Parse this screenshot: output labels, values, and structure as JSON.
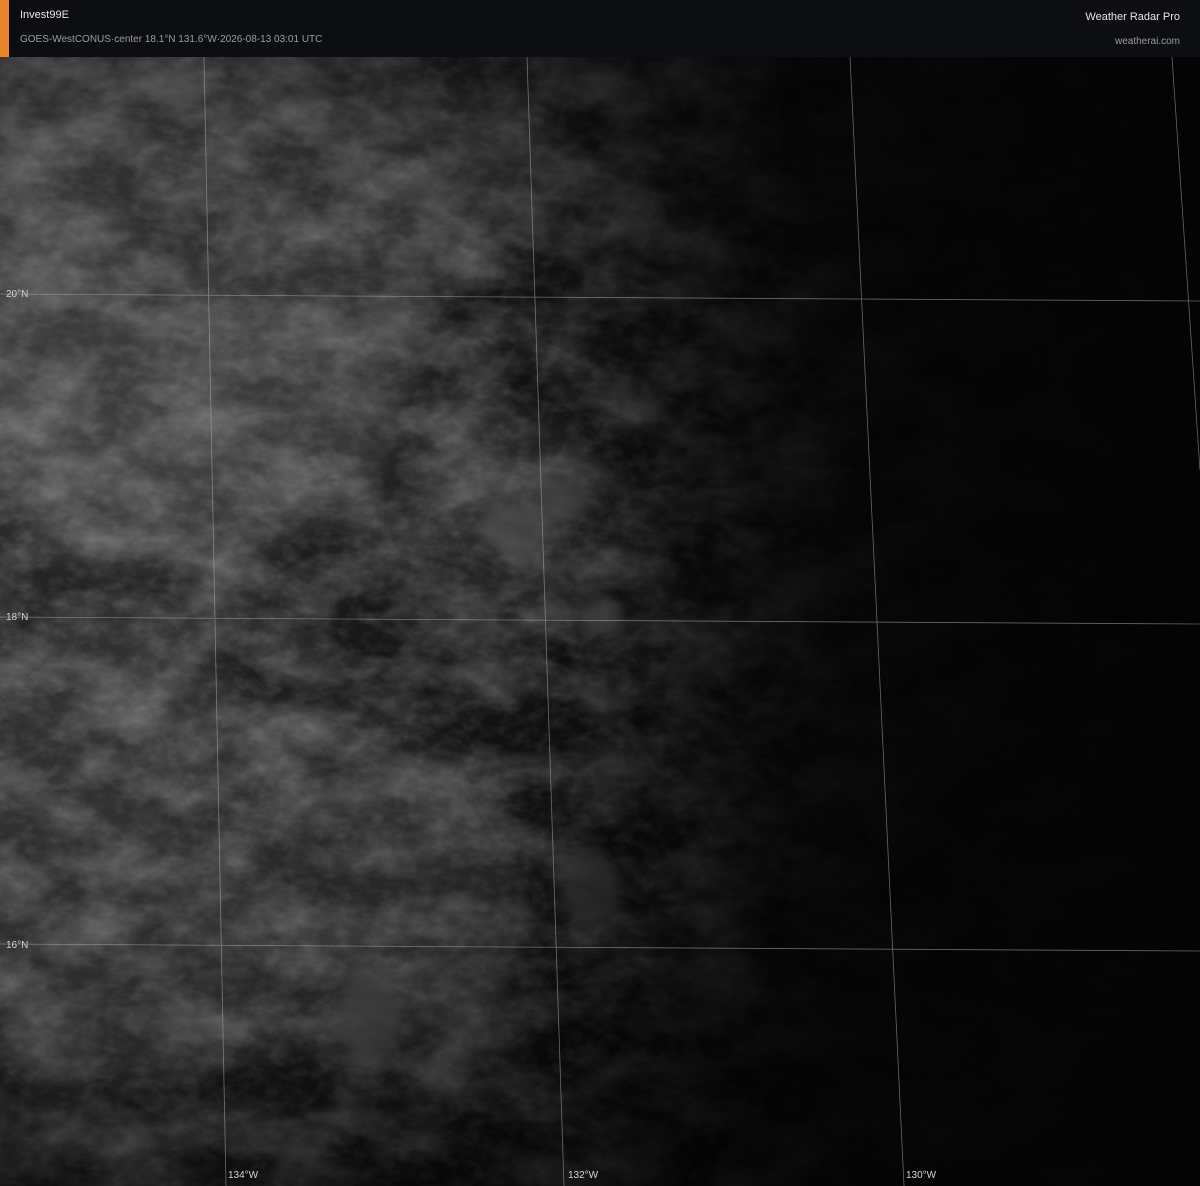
{
  "header": {
    "title": "Invest99E",
    "subtitle": "GOES-WestCONUS·center 18.1°N 131.6°W·2026-08-13 03:01 UTC",
    "brand": "Weather Radar Pro",
    "site": "weatherai.com"
  },
  "colors": {
    "accent": "#e8862a",
    "header_bg": "#0d0e12",
    "graticule": "#b5b5b5",
    "label": "#d2d2d2"
  },
  "graticule": {
    "latitudes": [
      {
        "label": "20°N"
      },
      {
        "label": "18°N"
      },
      {
        "label": "16°N"
      }
    ],
    "longitudes": [
      {
        "label": "134°W"
      },
      {
        "label": "132°W"
      },
      {
        "label": "130°W"
      }
    ]
  }
}
